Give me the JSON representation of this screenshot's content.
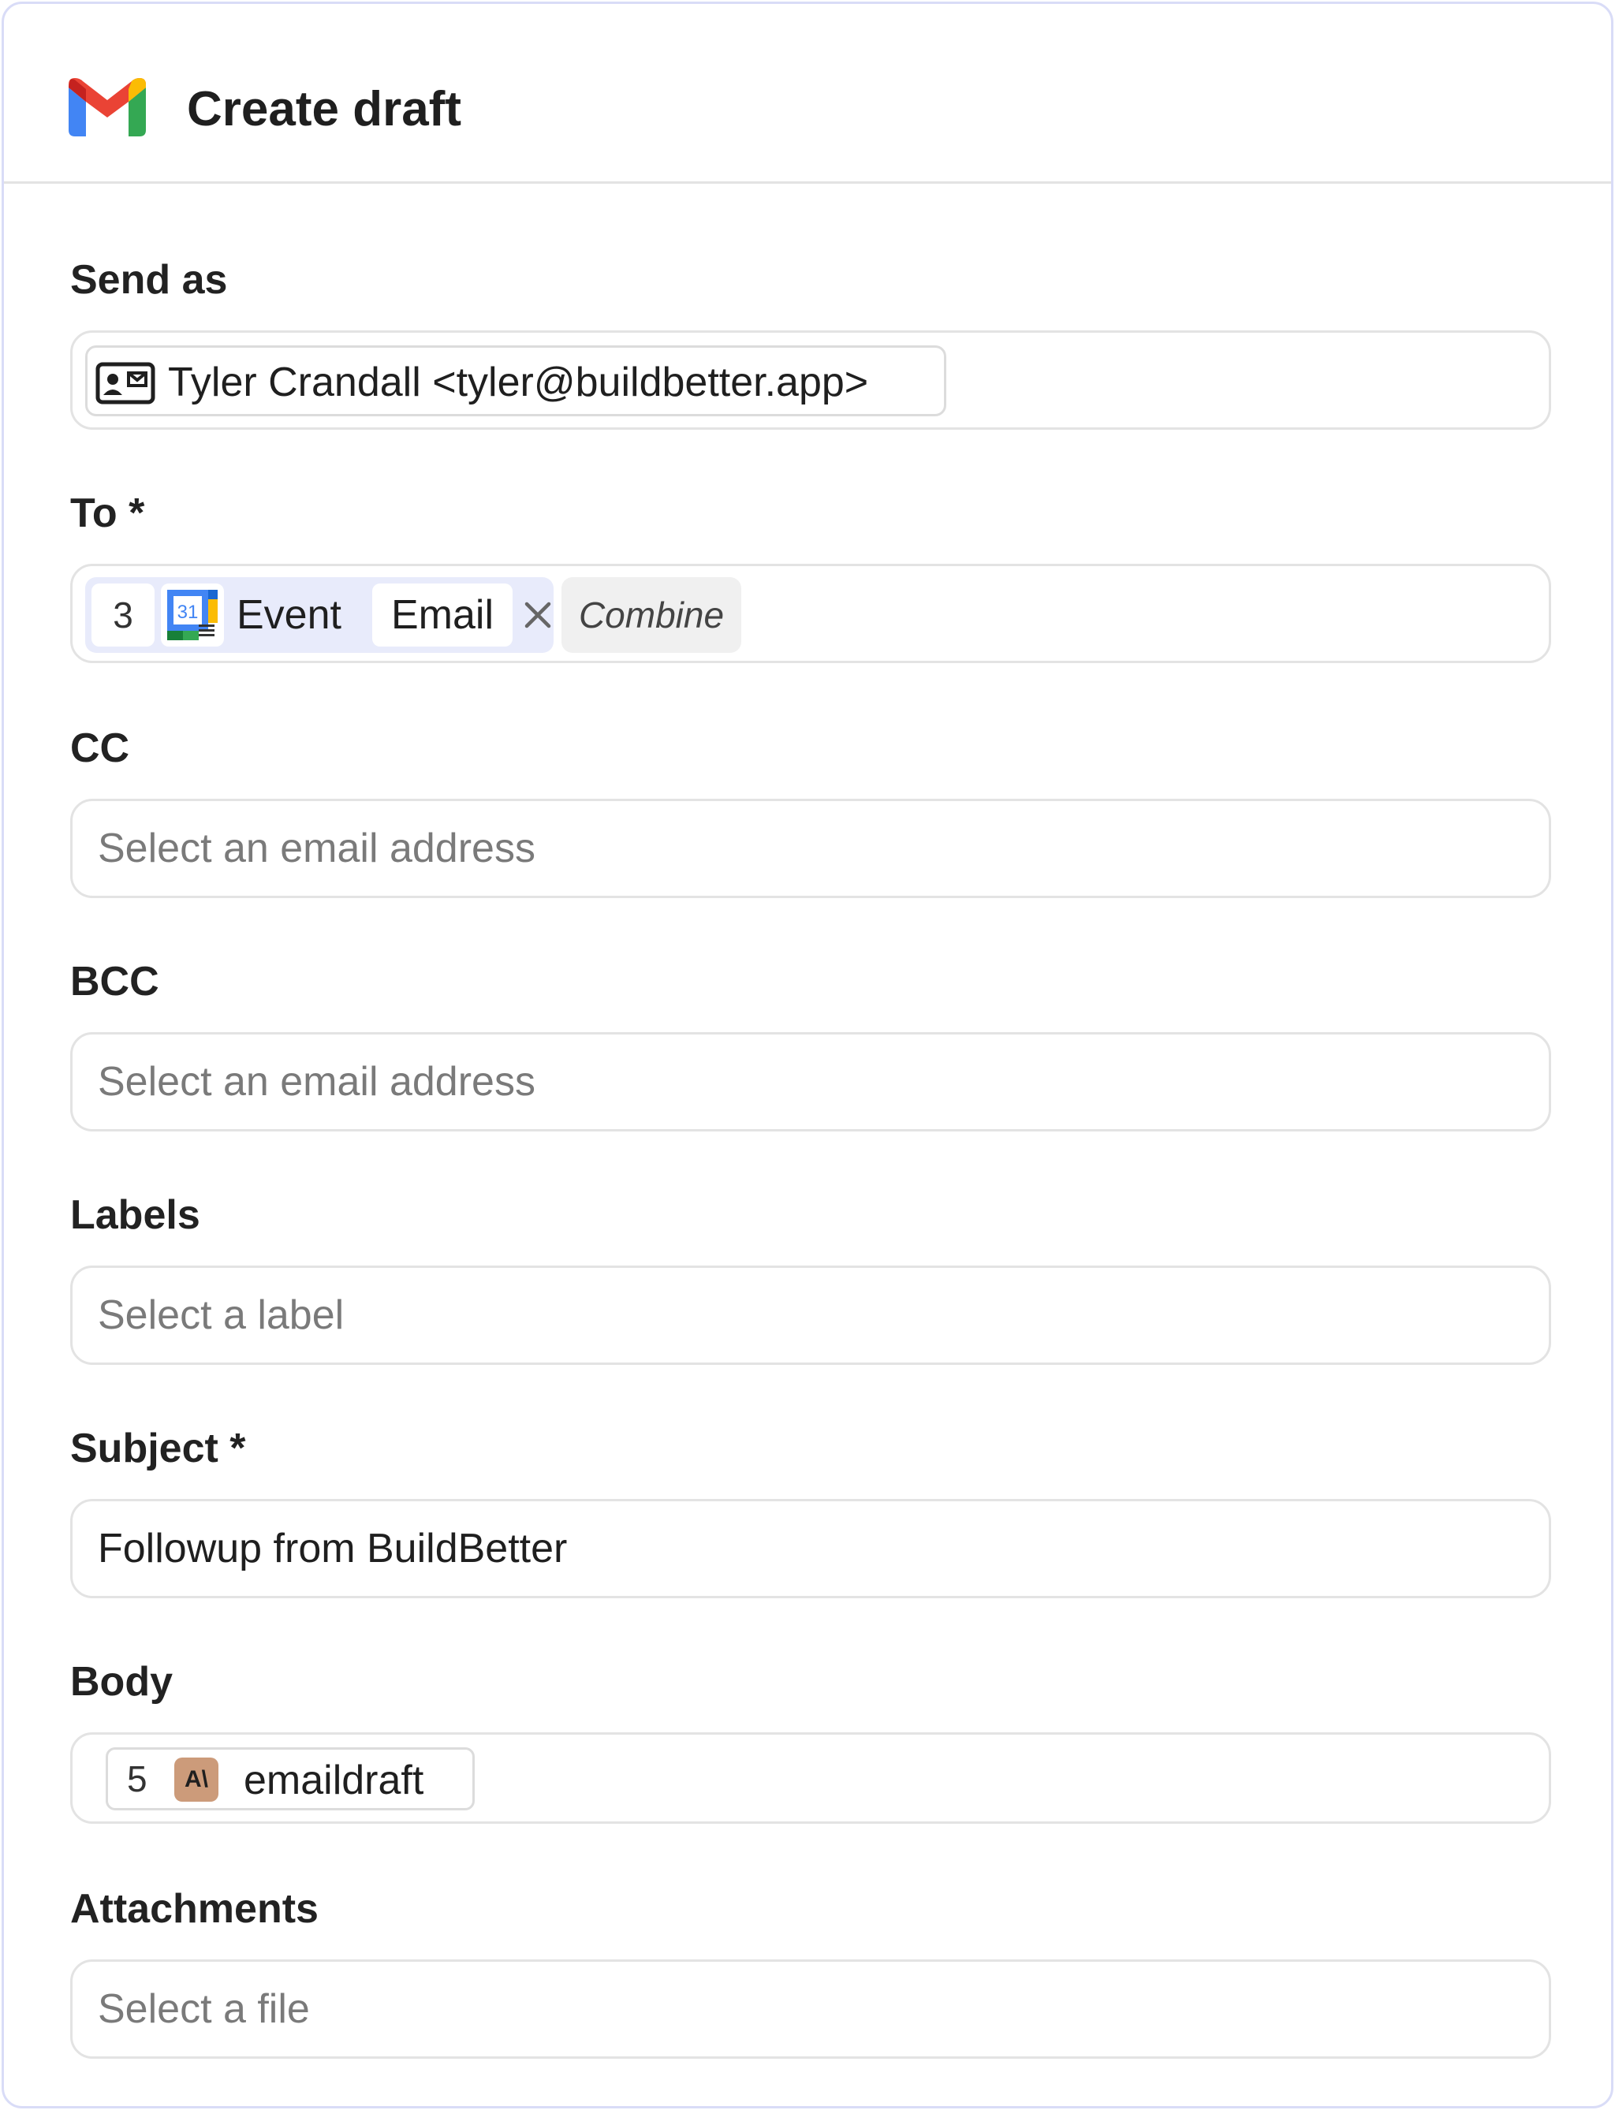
{
  "header": {
    "title": "Create draft",
    "icon": "gmail-icon"
  },
  "fields": {
    "send_as": {
      "label": "Send as",
      "value": "Tyler Crandall <tyler@buildbetter.app>",
      "icon": "contact-card-icon"
    },
    "to": {
      "label": "To *",
      "step_number": "3",
      "source_icon": "google-calendar-icon",
      "source_name": "Event",
      "field_name": "Email",
      "combine_label": "Combine"
    },
    "cc": {
      "label": "CC",
      "placeholder": "Select an email address"
    },
    "bcc": {
      "label": "BCC",
      "placeholder": "Select an email address"
    },
    "labels": {
      "label": "Labels",
      "placeholder": "Select a label"
    },
    "subject": {
      "label": "Subject *",
      "value": "Followup from BuildBetter"
    },
    "body": {
      "label": "Body",
      "step_number": "5",
      "source_icon": "anthropic-icon",
      "icon_text": "A\\",
      "field_name": "emaildraft"
    },
    "attachments": {
      "label": "Attachments",
      "placeholder": "Select a file"
    }
  },
  "colors": {
    "card_border": "#d9dcf7",
    "pill_bg": "#e8ebfb",
    "anthropic_bg": "#cc9b7a",
    "placeholder": "#7a7a7a"
  }
}
